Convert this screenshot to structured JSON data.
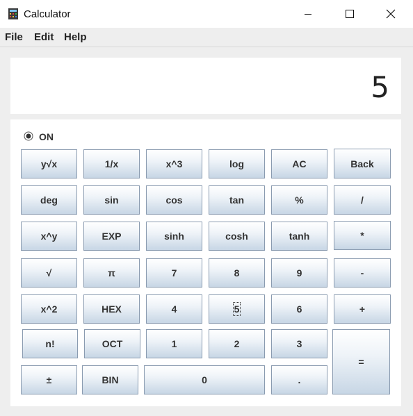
{
  "window": {
    "title": "Calculator"
  },
  "menu": {
    "file": "File",
    "edit": "Edit",
    "help": "Help"
  },
  "display": {
    "value": "5"
  },
  "power": {
    "label": "ON",
    "checked": true
  },
  "buttons": {
    "ysqrtx": "y√x",
    "reciprocal": "1/x",
    "cube": "x^3",
    "log": "log",
    "ac": "AC",
    "back": "Back",
    "deg": "deg",
    "sin": "sin",
    "cos": "cos",
    "tan": "tan",
    "percent": "%",
    "divide": "/",
    "power": "x^y",
    "exp": "EXP",
    "sinh": "sinh",
    "cosh": "cosh",
    "tanh": "tanh",
    "multiply": "*",
    "sqrt": "√",
    "pi": "π",
    "seven": "7",
    "eight": "8",
    "nine": "9",
    "minus": "-",
    "square": "x^2",
    "hex": "HEX",
    "four": "4",
    "five": "5",
    "six": "6",
    "plus": "+",
    "factorial": "n!",
    "oct": "OCT",
    "one": "1",
    "two": "2",
    "three": "3",
    "equals": "=",
    "plusminus": "±",
    "bin": "BIN",
    "zero": "0",
    "dot": "."
  }
}
